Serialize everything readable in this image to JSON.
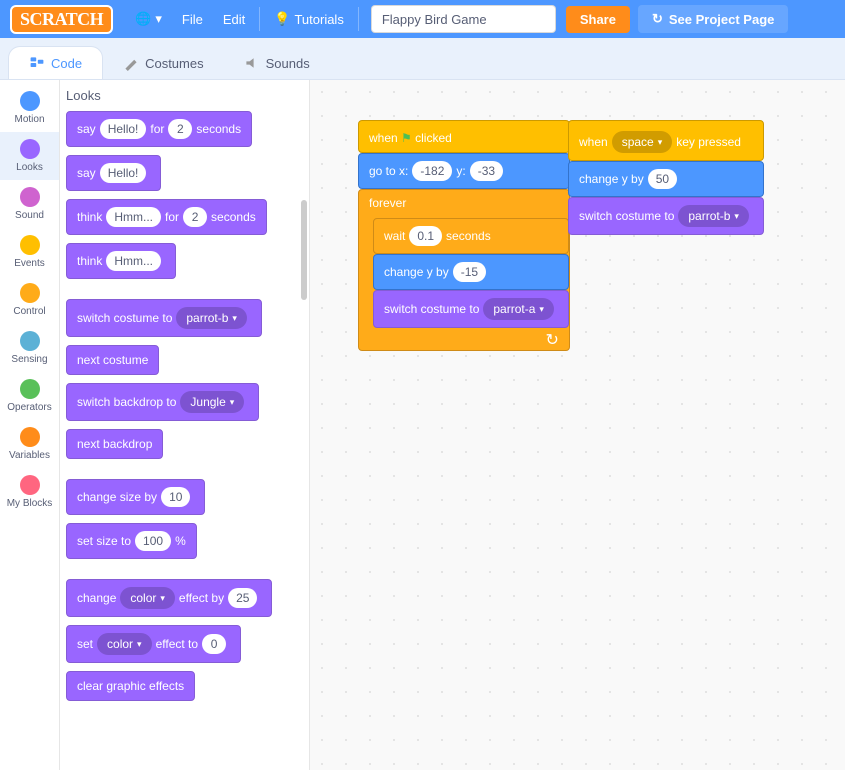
{
  "menubar": {
    "logo": "SCRATCH",
    "file": "File",
    "edit": "Edit",
    "tutorials": "Tutorials",
    "project_title": "Flappy Bird Game",
    "share": "Share",
    "see_page": "See Project Page"
  },
  "tabs": {
    "code": "Code",
    "costumes": "Costumes",
    "sounds": "Sounds"
  },
  "categories": [
    {
      "name": "Motion",
      "class": "c-motion"
    },
    {
      "name": "Looks",
      "class": "c-looks"
    },
    {
      "name": "Sound",
      "class": "c-sound"
    },
    {
      "name": "Events",
      "class": "c-events"
    },
    {
      "name": "Control",
      "class": "c-control"
    },
    {
      "name": "Sensing",
      "class": "c-sensing"
    },
    {
      "name": "Operators",
      "class": "c-operators"
    },
    {
      "name": "Variables",
      "class": "c-variables"
    },
    {
      "name": "My Blocks",
      "class": "c-myblocks"
    }
  ],
  "palette": {
    "header": "Looks",
    "say": "say",
    "for": "for",
    "seconds": "seconds",
    "hello": "Hello!",
    "two": "2",
    "think": "think",
    "hmm": "Hmm...",
    "switch_costume_to": "switch costume to",
    "parrotb": "parrot-b",
    "next_costume": "next costume",
    "switch_backdrop_to": "switch backdrop to",
    "jungle": "Jungle",
    "next_backdrop": "next backdrop",
    "change_size_by": "change size by",
    "ten": "10",
    "set_size_to": "set size to",
    "hundred": "100",
    "percent": "%",
    "change": "change",
    "color": "color",
    "effect_by": "effect by",
    "twentyfive": "25",
    "set": "set",
    "effect_to": "effect to",
    "zero": "0",
    "clear_effects": "clear graphic effects"
  },
  "workspace": {
    "stack1": {
      "when": "when",
      "clicked": "clicked",
      "go_to_x": "go to x:",
      "x": "-182",
      "y_label": "y:",
      "y": "-33",
      "forever": "forever",
      "wait": "wait",
      "wait_val": "0.1",
      "seconds": "seconds",
      "change_y_by": "change y by",
      "dy": "-15",
      "switch_costume_to": "switch costume to",
      "parrota": "parrot-a",
      "loop_icon": "↻"
    },
    "stack2": {
      "when": "when",
      "space": "space",
      "key_pressed": "key pressed",
      "change_y_by": "change y by",
      "dy": "50",
      "switch_costume_to": "switch costume to",
      "parrotb": "parrot-b"
    }
  }
}
